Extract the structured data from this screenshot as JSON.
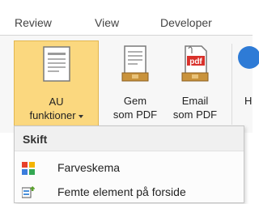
{
  "ribbon_tabs": [
    "Review",
    "View",
    "Developer"
  ],
  "buttons": {
    "au": {
      "line1": "AU",
      "line2": "funktioner"
    },
    "gem": {
      "line1": "Gem",
      "line2": "som PDF"
    },
    "email": {
      "line1": "Email",
      "line2": "som PDF"
    },
    "partial": {
      "line1": "H"
    }
  },
  "icons": {
    "au": "document-icon",
    "gem": "pdf-document-icon",
    "email": "pdf-email-icon",
    "partial": "blue-circle-icon",
    "farveskema": "color-scheme-icon",
    "femte": "element-icon"
  },
  "menu": {
    "header": "Skift",
    "items": [
      "Farveskema",
      "Femte element på forside"
    ]
  },
  "colors": {
    "selected_button_bg": "#fbd87f",
    "selected_button_border": "#e1b650",
    "pdf_red": "#d9312b"
  }
}
